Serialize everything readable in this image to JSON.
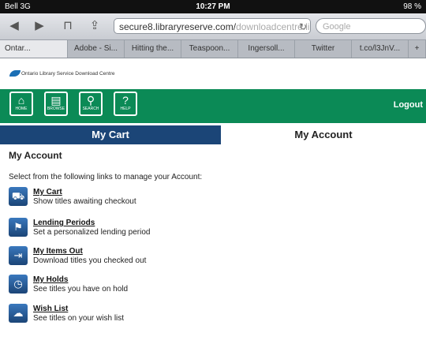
{
  "status": {
    "carrier": "Bell 3G",
    "time": "10:27 PM",
    "battery": "98 %"
  },
  "browser": {
    "url_main": "secure8.libraryreserve.com/",
    "url_rest": "downloadcentre.libra",
    "search_placeholder": "Google",
    "tabs": [
      "Ontar...",
      "Adobe - Si...",
      "Hitting the...",
      "Teaspoon...",
      "Ingersoll...",
      "Twitter",
      "t.co/l3JnV...",
      "+"
    ]
  },
  "site": {
    "logo_text": "Ontario Library Service Download Centre",
    "nav": [
      "HOME",
      "BROWSE",
      "SEARCH",
      "HELP"
    ],
    "logout": "Logout"
  },
  "account_tabs": {
    "cart": "My Cart",
    "account": "My Account"
  },
  "main": {
    "heading": "My Account",
    "intro": "Select from the following links to manage your Account:",
    "items": [
      {
        "link": "My Cart",
        "desc": "Show titles awaiting checkout",
        "icon": "cart-icon"
      },
      {
        "link": "Lending Periods",
        "desc": "Set a personalized lending period",
        "icon": "lending-icon"
      },
      {
        "link": "My Items Out",
        "desc": "Download titles you checked out",
        "icon": "items-out-icon"
      },
      {
        "link": "My Holds",
        "desc": "See titles you have on hold",
        "icon": "holds-icon"
      },
      {
        "link": "Wish List",
        "desc": "See titles on your wish list",
        "icon": "wishlist-icon"
      }
    ]
  }
}
